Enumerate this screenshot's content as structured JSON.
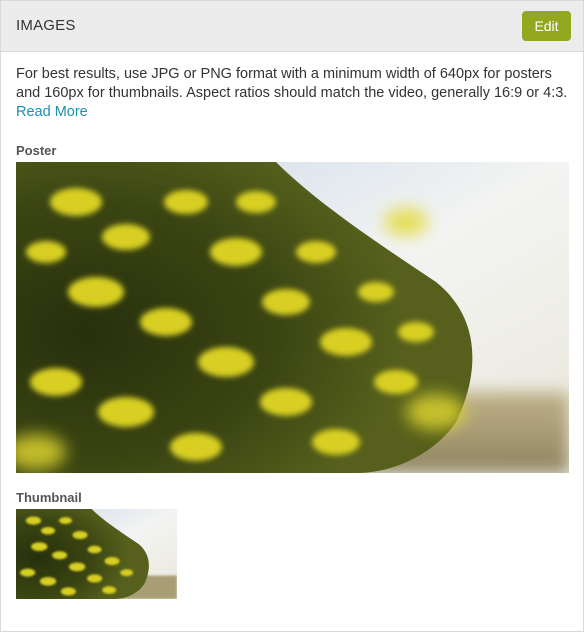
{
  "panel": {
    "title": "IMAGES",
    "edit_label": "Edit",
    "description": "For best results, use JPG or PNG format with a minimum width of 640px for posters and 160px for thumbnails. Aspect ratios should match the video, generally 16:9 or 4:3.",
    "read_more_label": "Read More"
  },
  "poster": {
    "label": "Poster"
  },
  "thumbnail": {
    "label": "Thumbnail"
  },
  "colors": {
    "accent_button": "#93a81e",
    "link": "#1b8fb4",
    "header_bg": "#ececec"
  }
}
